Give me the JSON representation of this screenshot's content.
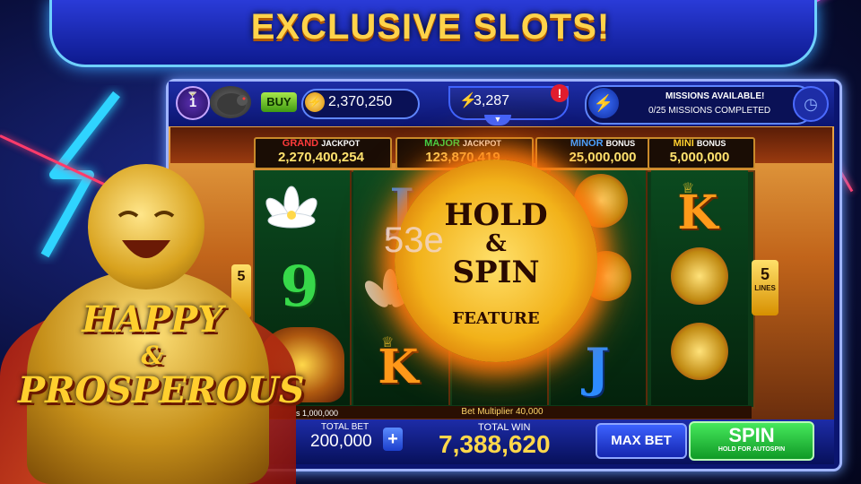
{
  "banner": {
    "title": "EXCLUSIVE SLOTS!"
  },
  "topbar": {
    "level": "1",
    "buy_label": "BUY",
    "coins": "2,370,250",
    "energy": "3,287",
    "alert": "!",
    "missions_available": "MISSIONS AVAILABLE!",
    "missions_completed": "0/25 MISSIONS COMPLETED"
  },
  "jackpots": [
    {
      "name": "GRAND",
      "type": "JACKPOT",
      "value": "2,270,400,254",
      "color": "#ff3b3b"
    },
    {
      "name": "MAJOR",
      "type": "JACKPOT",
      "value": "123,870,419",
      "color": "#37d84a"
    },
    {
      "name": "MINOR",
      "type": "BONUS",
      "value": "25,000,000",
      "color": "#4aa0ff"
    },
    {
      "name": "MINI",
      "type": "BONUS",
      "value": "5,000,000",
      "color": "#ffcf2e"
    }
  ],
  "reels": {
    "col1": [
      "lotus",
      "9",
      "pot"
    ],
    "col2": [
      "J",
      "lotus",
      "K"
    ],
    "col4": [
      "buddha",
      "buddha",
      "J"
    ],
    "col5": [
      "K",
      "buddha",
      "buddha"
    ]
  },
  "lines": {
    "count": "5",
    "label": "LINES",
    "left_count": "5"
  },
  "feature": {
    "line1": "HOLD",
    "line2": "&",
    "line3": "SPIN",
    "line4": "FEATURE"
  },
  "watermark": "53e",
  "game_title": {
    "line1": "HAPPY",
    "line2": "&",
    "line3": "PROSPEROUS"
  },
  "bet_multiplier": "Bet Multiplier 40,000",
  "lines_bet_note": "s 1,000,000",
  "bottom": {
    "total_bet_label": "TOTAL BET",
    "total_bet": "200,000",
    "plus": "+",
    "total_win_label": "TOTAL WIN",
    "total_win": "7,388,620",
    "max_bet": "MAX BET",
    "spin": "SPIN",
    "spin_sub": "HOLD FOR AUTOSPIN"
  },
  "icons": [
    "cocktail-icon",
    "piggy-bank-icon",
    "coin-icon",
    "lightning-icon",
    "alert-icon",
    "missions-bolt-icon",
    "clock-icon",
    "plus-icon"
  ]
}
